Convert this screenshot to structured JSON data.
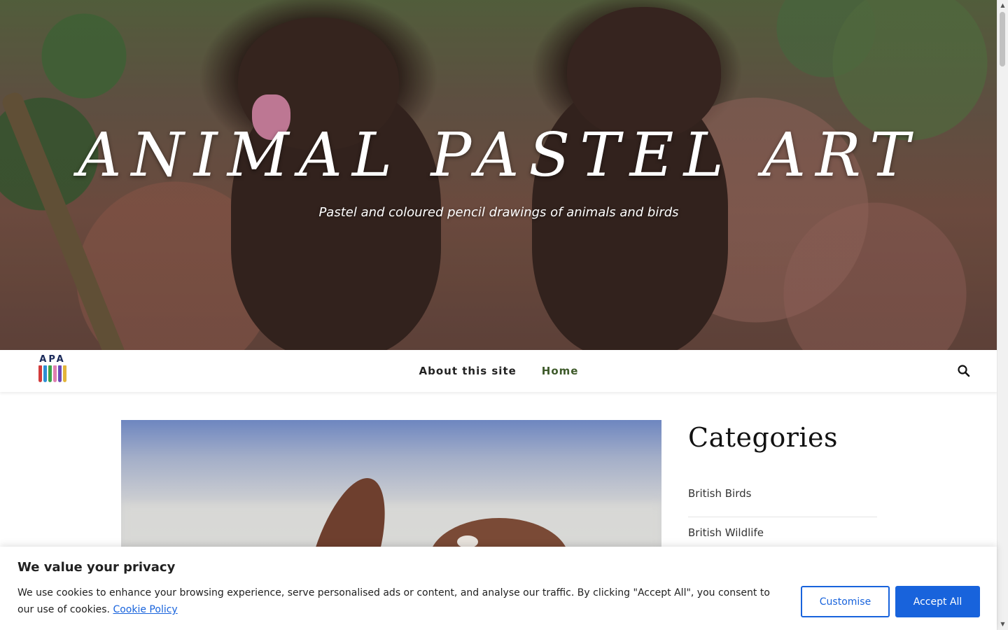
{
  "hero": {
    "title": "ANIMAL PASTEL ART",
    "tagline": "Pastel and coloured pencil drawings of animals and birds"
  },
  "nav": {
    "logo_letters": "APA",
    "links": [
      {
        "label": "About this site"
      },
      {
        "label": "Home",
        "active": true
      }
    ],
    "search_icon": "search-icon"
  },
  "sidebar": {
    "heading": "Categories",
    "categories": [
      "British Birds",
      "British Wildlife"
    ]
  },
  "cookie_banner": {
    "title": "We value your privacy",
    "text": "We use cookies to enhance your browsing experience, serve personalised ads or content, and analyse our traffic. By clicking \"Accept All\", you consent to our use of cookies.",
    "policy_link": "Cookie Policy",
    "customise_label": "Customise",
    "accept_label": "Accept All"
  },
  "colors": {
    "accent_blue": "#1863dc",
    "nav_active": "#3e5a2a"
  }
}
